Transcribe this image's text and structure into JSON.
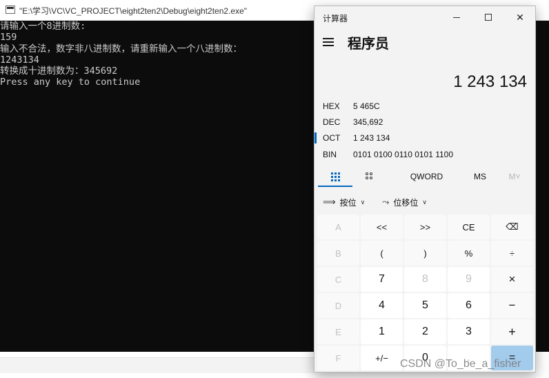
{
  "console": {
    "title": "\"E:\\学习\\VC\\VC_PROJECT\\eight2ten2\\Debug\\eight2ten2.exe\"",
    "lines": [
      "请输入一个8进制数:",
      "159",
      "输入不合法，数字非八进制数，请重新输入一个八进制数：",
      "1243134",
      "转换成十进制数为：345692",
      "Press any key to continue"
    ]
  },
  "calculator": {
    "window_title": "计算器",
    "window_buttons": {
      "minimize": "minimize-icon",
      "maximize": "maximize-icon",
      "close": "✕"
    },
    "menu_icon": "hamburger-menu-icon",
    "mode": "程序员",
    "display": "1 243 134",
    "radix": [
      {
        "label": "HEX",
        "value": "5 465C"
      },
      {
        "label": "DEC",
        "value": "345,692"
      },
      {
        "label": "OCT",
        "value": "1 243 134",
        "selected": true
      },
      {
        "label": "BIN",
        "value": "0101 0100 0110 0101 1100"
      }
    ],
    "tabs": {
      "keypad_icon": "full-keypad-icon",
      "bits_icon": "bit-toggle-keypad-icon",
      "word": "QWORD",
      "ms": "MS",
      "mv": "M˅"
    },
    "bit_menus": {
      "bitwise": {
        "label": "按位",
        "icon": "bitwise-icon"
      },
      "shift": {
        "label": "位移位",
        "icon": "bit-shift-icon"
      }
    },
    "keys": [
      [
        "A",
        "<<",
        ">>",
        "CE",
        "⌫"
      ],
      [
        "B",
        "(",
        ")",
        "%",
        "÷"
      ],
      [
        "C",
        "7",
        "8",
        "9",
        "×"
      ],
      [
        "D",
        "4",
        "5",
        "6",
        "−"
      ],
      [
        "E",
        "1",
        "2",
        "3",
        "+"
      ],
      [
        "F",
        "+/−",
        "0",
        ".",
        "="
      ]
    ],
    "accent_color": "#0067c0",
    "equals_color": "#a3cbec"
  },
  "watermark": "CSDN @To_be_a_fisher"
}
